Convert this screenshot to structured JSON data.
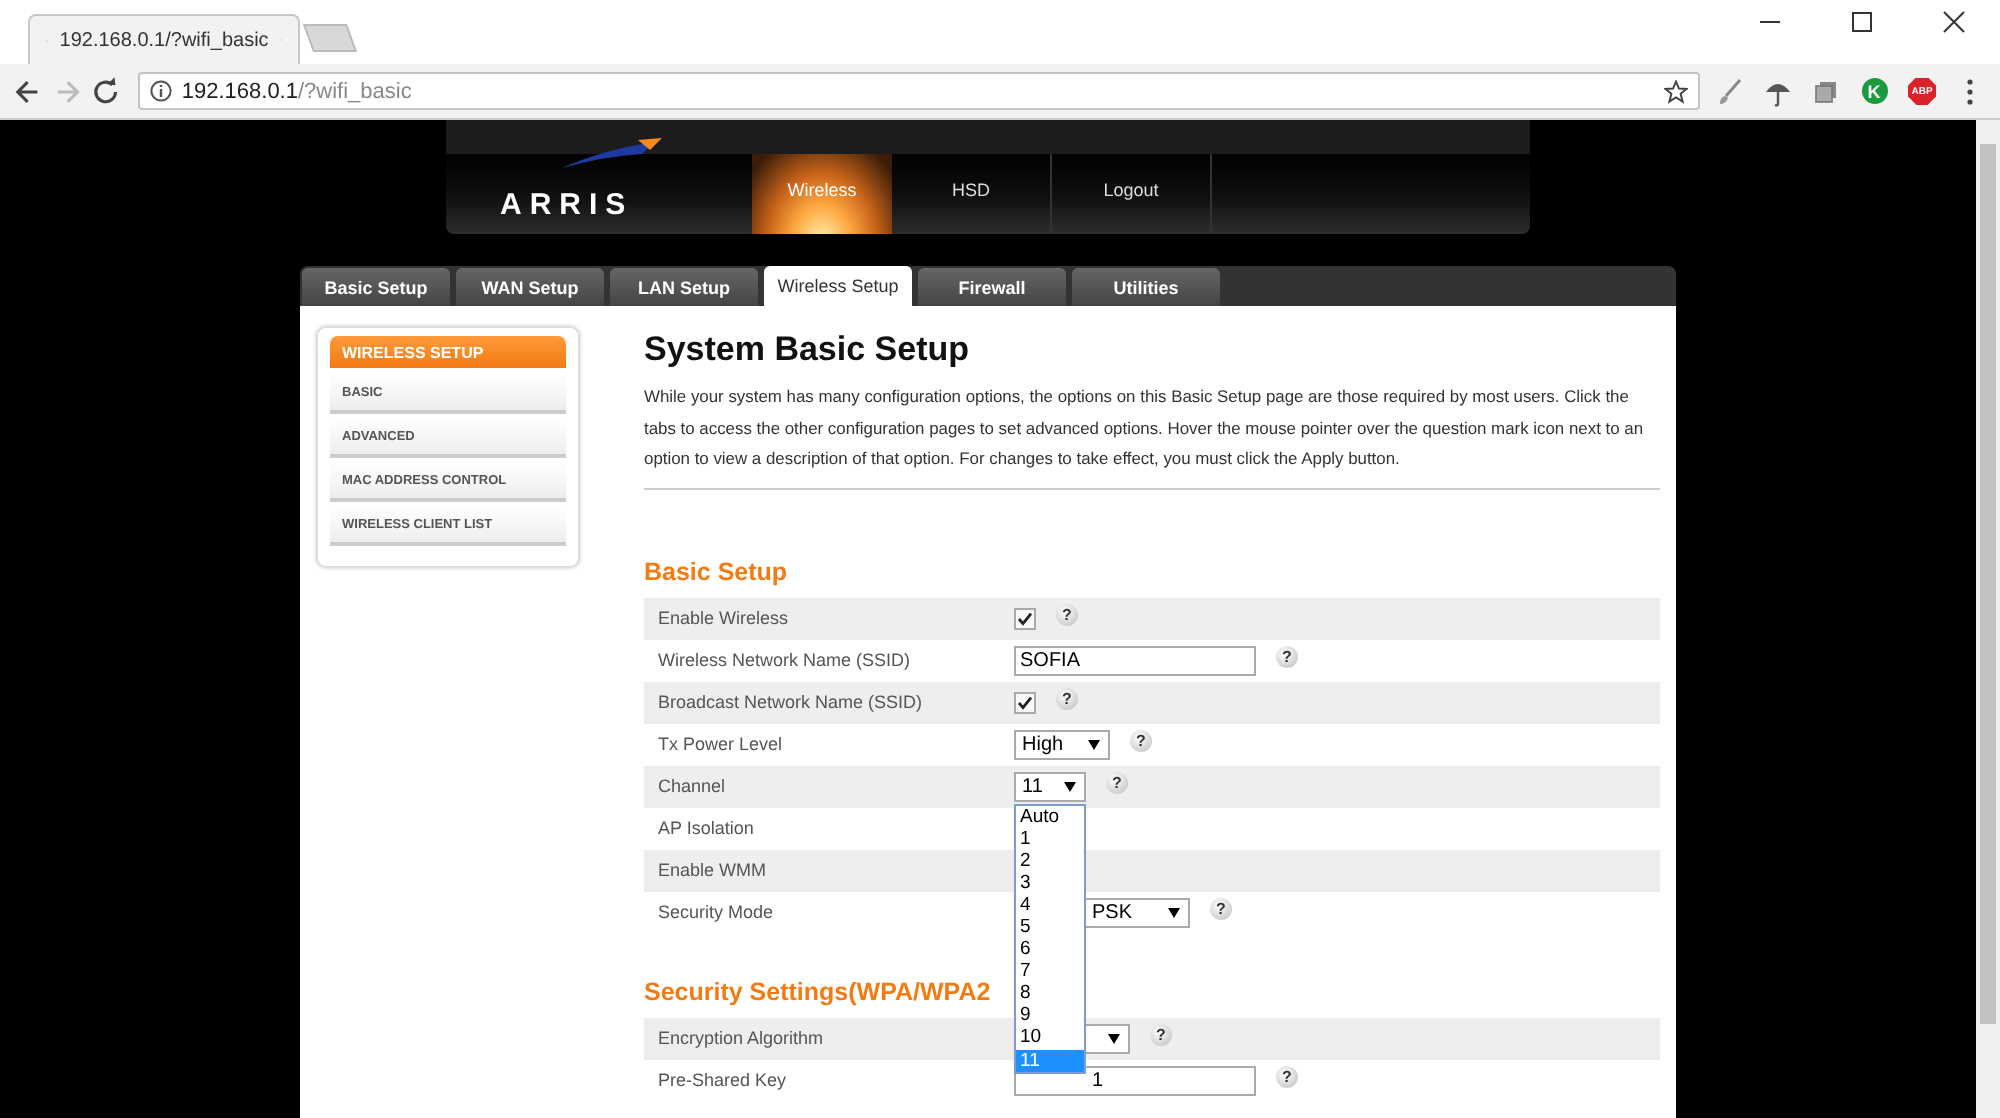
{
  "browser": {
    "tab_title": "192.168.0.1/?wifi_basic",
    "address": {
      "host": "192.168.0.1",
      "path": "/?wifi_basic"
    },
    "extensions": [
      {
        "kind": "brush"
      },
      {
        "kind": "umbrella"
      },
      {
        "kind": "copy"
      },
      {
        "kind": "letter",
        "text": "K",
        "color": "#1a9c3e"
      },
      {
        "kind": "badge",
        "text": "ABP",
        "color": "#d8232a"
      }
    ]
  },
  "header": {
    "logo": "ARRIS",
    "nav": [
      {
        "label": "Wireless",
        "selected": true
      },
      {
        "label": "HSD",
        "selected": false
      },
      {
        "label": "Logout",
        "selected": false
      }
    ]
  },
  "tabs": [
    {
      "label": "Basic Setup",
      "selected": false
    },
    {
      "label": "WAN Setup",
      "selected": false
    },
    {
      "label": "LAN Setup",
      "selected": false
    },
    {
      "label": "Wireless Setup",
      "selected": true
    },
    {
      "label": "Firewall",
      "selected": false
    },
    {
      "label": "Utilities",
      "selected": false
    }
  ],
  "sidebar": {
    "title": "WIRELESS SETUP",
    "items": [
      {
        "label": "BASIC",
        "selected": false
      },
      {
        "label": "ADVANCED",
        "selected": false
      },
      {
        "label": "MAC ADDRESS CONTROL",
        "selected": false
      },
      {
        "label": "WIRELESS CLIENT LIST",
        "selected": false
      }
    ]
  },
  "page": {
    "title": "System Basic Setup",
    "intro": "While your system has many configuration options, the options on this Basic Setup page are those required by most users. Click the tabs to access the other configuration pages to set advanced options. Hover the mouse pointer over the question mark icon next to an option to view a description of that option. For changes to take effect, you must click the Apply button."
  },
  "sections": [
    {
      "title": "Basic Setup",
      "rows": [
        {
          "label": "Enable Wireless",
          "kind": "checkbox",
          "checked": true,
          "help": "?"
        },
        {
          "label": "Wireless Network Name (SSID)",
          "kind": "text",
          "value": "SOFIA",
          "help": "?"
        },
        {
          "label": "Broadcast Network Name (SSID)",
          "kind": "checkbox",
          "checked": true,
          "help": "?"
        },
        {
          "label": "Tx Power Level",
          "kind": "select",
          "value": "High",
          "help": "?"
        },
        {
          "label": "Channel",
          "kind": "select",
          "value": "11",
          "help": "?",
          "options": [
            {
              "label": "Auto",
              "selected": false
            },
            {
              "label": "1",
              "selected": false
            },
            {
              "label": "2",
              "selected": false
            },
            {
              "label": "3",
              "selected": false
            },
            {
              "label": "4",
              "selected": false
            },
            {
              "label": "5",
              "selected": false
            },
            {
              "label": "6",
              "selected": false
            },
            {
              "label": "7",
              "selected": false
            },
            {
              "label": "8",
              "selected": false
            },
            {
              "label": "9",
              "selected": false
            },
            {
              "label": "10",
              "selected": false
            },
            {
              "label": "11",
              "selected": true
            }
          ]
        },
        {
          "label": "AP Isolation",
          "kind": "covered"
        },
        {
          "label": "Enable WMM",
          "kind": "covered"
        },
        {
          "label": "Security Mode",
          "kind": "select",
          "value": "PSK",
          "help": "?",
          "covered": true
        }
      ]
    },
    {
      "title": "Security Settings(WPA/WPA2",
      "rows": [
        {
          "label": "Encryption Algorithm",
          "kind": "select",
          "help": "?",
          "covered": true
        },
        {
          "label": "Pre-Shared Key",
          "kind": "text",
          "value": "1",
          "help": "?",
          "covered": true
        }
      ]
    }
  ]
}
